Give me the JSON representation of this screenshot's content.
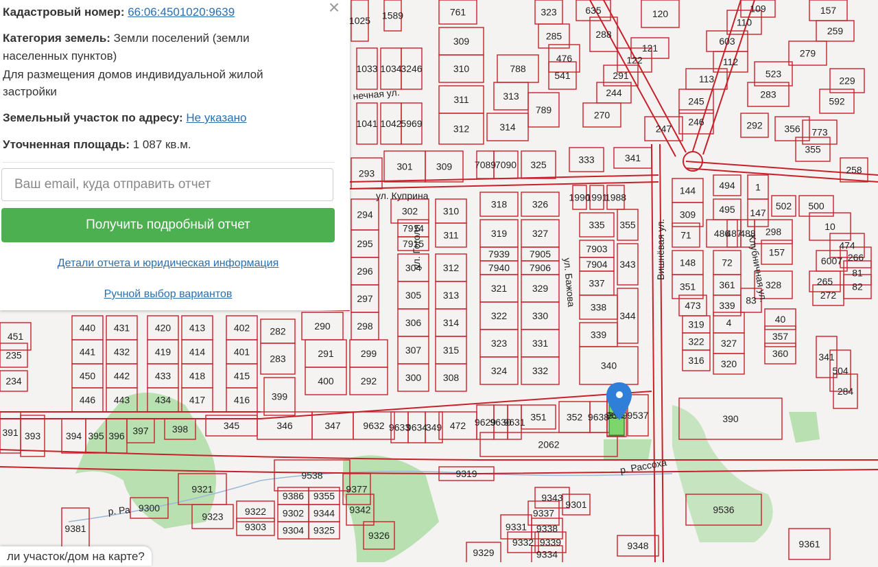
{
  "info": {
    "cadastral_label": "Кадастровый номер:",
    "cadastral_number": "66:06:4501020:9639",
    "category_label": "Категория земель:",
    "category_value": "Земли поселений (земли",
    "category_value_2": "населенных пунктов)",
    "purpose_line_1": "Для размещения домов индивидуальной жилой",
    "purpose_line_2": "застройки",
    "address_label": "Земельный участок по адресу:",
    "address_value": "Не указано",
    "area_label": "Уточненная площадь:",
    "area_value": "1 087 кв.м."
  },
  "form": {
    "email_placeholder": "Ваш email, куда отправить отчет",
    "submit_label": "Получить подробный отчет",
    "details_link": "Детали отчета и юридическая информация",
    "manual_link": "Ручной выбор вариантов"
  },
  "close_icon": "close-icon",
  "bottom_tip": "ли участок/дом на карте?",
  "colors": {
    "accent_green": "#4caf50",
    "link_blue": "#2a6fb0",
    "parcel_border": "#c8202a",
    "selected_parcel": "#7dd66b",
    "marker_blue": "#2f7fd8"
  },
  "map": {
    "streets": [
      "ул. Куприна",
      "ул. Гоголя",
      "ул. Бажова",
      "Вишнёвая ул.",
      "Клубничная ул.",
      "р. Рассоха",
      "р. Ра",
      "нечная ул."
    ],
    "parcels": [
      "1025",
      "1589",
      "761",
      "323",
      "635",
      "109",
      "157",
      "120",
      "285",
      "288",
      "110",
      "259",
      "309",
      "476",
      "603",
      "310",
      "121",
      "279",
      "788",
      "122",
      "112",
      "523",
      "229",
      "1033",
      "1034",
      "3246",
      "541",
      "291",
      "113",
      "311",
      "313",
      "244",
      "245",
      "283",
      "592",
      "1041",
      "1042",
      "5969",
      "789",
      "270",
      "246",
      "292",
      "356",
      "773",
      "312",
      "314",
      "247",
      "355",
      "293",
      "301",
      "309",
      "7089",
      "7090",
      "325",
      "333",
      "341",
      "258",
      "294",
      "302",
      "310",
      "318",
      "326",
      "1990",
      "1991",
      "1988",
      "144",
      "494",
      "1",
      "502",
      "500",
      "10",
      "295",
      "7914",
      "7915",
      "311",
      "319",
      "327",
      "335",
      "355",
      "309",
      "495",
      "147",
      "298",
      "474",
      "7939",
      "7905",
      "7903",
      "71",
      "486",
      "487",
      "488",
      "6007",
      "266",
      "296",
      "304",
      "312",
      "7940",
      "7906",
      "7904",
      "343",
      "148",
      "72",
      "157",
      "265",
      "81",
      "297",
      "305",
      "313",
      "321",
      "329",
      "337",
      "351",
      "361",
      "328",
      "272",
      "82",
      "290",
      "298",
      "306",
      "314",
      "322",
      "330",
      "338",
      "344",
      "473",
      "339",
      "83",
      "440",
      "431",
      "420",
      "413",
      "402",
      "282",
      "307",
      "315",
      "323",
      "331",
      "339",
      "319",
      "4",
      "40",
      "341",
      "451",
      "441",
      "432",
      "419",
      "414",
      "401",
      "283",
      "291",
      "299",
      "324",
      "332",
      "340",
      "322",
      "327",
      "357",
      "235",
      "450",
      "442",
      "433",
      "418",
      "415",
      "400",
      "292",
      "300",
      "308",
      "316",
      "320",
      "360",
      "504",
      "234",
      "446",
      "443",
      "434",
      "417",
      "416",
      "399",
      "284",
      "9629",
      "9630",
      "9631",
      "351",
      "352",
      "9638",
      "354",
      "9537",
      "390",
      "391",
      "393",
      "394",
      "395",
      "396",
      "397",
      "398",
      "345",
      "346",
      "347",
      "9632",
      "9633",
      "9634",
      "349",
      "472",
      "2062",
      "9319",
      "9538",
      "9321",
      "9377",
      "9386",
      "9355",
      "9322",
      "9323",
      "9342",
      "9343",
      "9301",
      "9302",
      "9344",
      "9303",
      "9304",
      "9325",
      "9326",
      "9331",
      "9337",
      "9338",
      "9332",
      "9339",
      "9334",
      "9329",
      "9348",
      "9536",
      "9381",
      "9361",
      "9300",
      "9639"
    ]
  }
}
